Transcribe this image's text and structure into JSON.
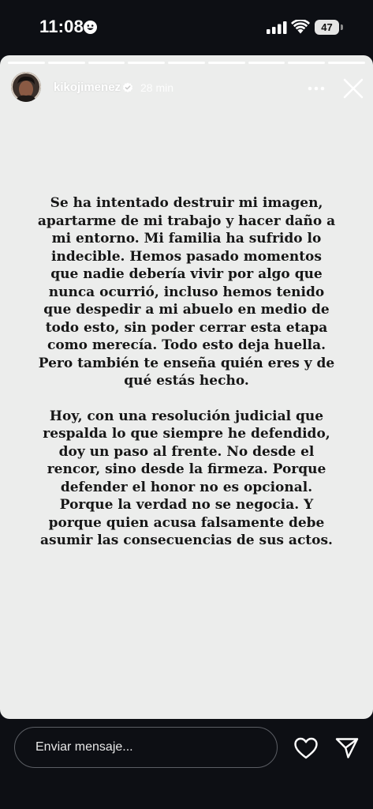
{
  "status_bar": {
    "time": "11:08",
    "battery": "47",
    "status_icons": [
      "smiley-icon",
      "signal-icon",
      "wifi-icon",
      "battery-icon"
    ]
  },
  "story_header": {
    "username": "kikojimenez",
    "verified": true,
    "time_ago": "28 min",
    "progress_segments": 9,
    "current_segment": 9,
    "icons": [
      "avatar",
      "verified-icon",
      "more-icon",
      "close-icon"
    ]
  },
  "story_text": {
    "paragraph_1": "Se ha intentado destruir mi imagen, apartarme de mi trabajo y hacer daño a mi entorno. Mi familia ha sufrido lo indecible. Hemos pasado momentos que nadie debería vivir por algo que nunca ocurrió, incluso hemos tenido que despedir a mi abuelo en medio de todo esto, sin poder cerrar esta etapa como merecía. Todo esto deja huella. Pero también te enseña quién eres y de qué estás hecho.",
    "paragraph_2": "Hoy, con una resolución judicial que respalda lo que siempre he defendido, doy un paso al frente. No desde el rencor, sino desde la firmeza. Porque defender el honor no es opcional. Porque la verdad no se negocia. Y porque quien acusa falsamente debe asumir las consecuencias de sus actos."
  },
  "reply_bar": {
    "placeholder": "Enviar mensaje...",
    "icons": [
      "heart-icon",
      "send-icon"
    ]
  },
  "colors": {
    "background": "#0d0f14",
    "story_background": "#ecedec",
    "story_text": "#161616",
    "header_text": "#ffffff"
  }
}
